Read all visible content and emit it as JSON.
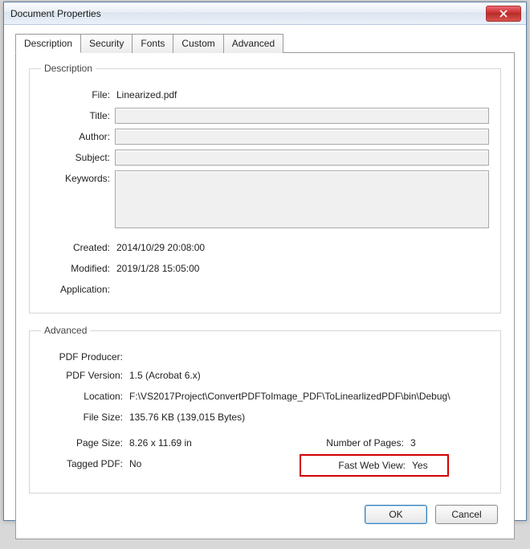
{
  "window": {
    "title": "Document Properties"
  },
  "tabs": {
    "description": "Description",
    "security": "Security",
    "fonts": "Fonts",
    "custom": "Custom",
    "advanced": "Advanced"
  },
  "description": {
    "legend": "Description",
    "labels": {
      "file": "File:",
      "title": "Title:",
      "author": "Author:",
      "subject": "Subject:",
      "keywords": "Keywords:",
      "created": "Created:",
      "modified": "Modified:",
      "application": "Application:"
    },
    "values": {
      "file": "Linearized.pdf",
      "title": "",
      "author": "",
      "subject": "",
      "keywords": "",
      "created": "2014/10/29 20:08:00",
      "modified": "2019/1/28 15:05:00",
      "application": ""
    }
  },
  "advanced": {
    "legend": "Advanced",
    "labels": {
      "producer": "PDF Producer:",
      "version": "PDF Version:",
      "location": "Location:",
      "filesize": "File Size:",
      "pagesize": "Page Size:",
      "numpages": "Number of Pages:",
      "tagged": "Tagged PDF:",
      "fastweb": "Fast Web View:"
    },
    "values": {
      "producer": "",
      "version": "1.5 (Acrobat 6.x)",
      "location": "F:\\VS2017Project\\ConvertPDFToImage_PDF\\ToLinearlizedPDF\\bin\\Debug\\",
      "filesize": "135.76 KB (139,015 Bytes)",
      "pagesize": "8.26 x 11.69 in",
      "numpages": "3",
      "tagged": "No",
      "fastweb": "Yes"
    }
  },
  "buttons": {
    "ok": "OK",
    "cancel": "Cancel"
  }
}
